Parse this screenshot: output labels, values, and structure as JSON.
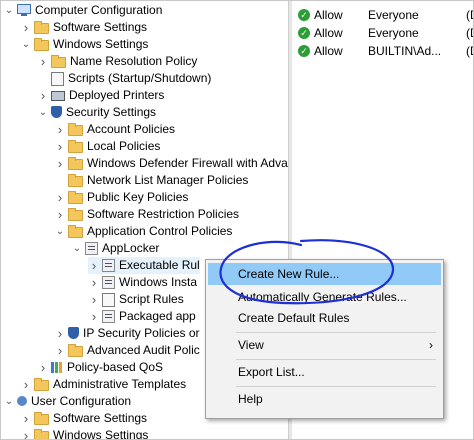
{
  "tree": [
    {
      "label": "Computer Configuration",
      "indent": 0,
      "toggle": "open",
      "icon": "pc"
    },
    {
      "label": "Software Settings",
      "indent": 1,
      "toggle": "closed",
      "icon": "folder"
    },
    {
      "label": "Windows Settings",
      "indent": 1,
      "toggle": "open",
      "icon": "folder"
    },
    {
      "label": "Name Resolution Policy",
      "indent": 2,
      "toggle": "closed",
      "icon": "folder"
    },
    {
      "label": "Scripts (Startup/Shutdown)",
      "indent": 2,
      "toggle": "none",
      "icon": "scroll"
    },
    {
      "label": "Deployed Printers",
      "indent": 2,
      "toggle": "closed",
      "icon": "printer"
    },
    {
      "label": "Security Settings",
      "indent": 2,
      "toggle": "open",
      "icon": "shield"
    },
    {
      "label": "Account Policies",
      "indent": 3,
      "toggle": "closed",
      "icon": "folder"
    },
    {
      "label": "Local Policies",
      "indent": 3,
      "toggle": "closed",
      "icon": "folder"
    },
    {
      "label": "Windows Defender Firewall with Advar",
      "indent": 3,
      "toggle": "closed",
      "icon": "folder"
    },
    {
      "label": "Network List Manager Policies",
      "indent": 3,
      "toggle": "none",
      "icon": "folder"
    },
    {
      "label": "Public Key Policies",
      "indent": 3,
      "toggle": "closed",
      "icon": "folder"
    },
    {
      "label": "Software Restriction Policies",
      "indent": 3,
      "toggle": "closed",
      "icon": "folder"
    },
    {
      "label": "Application Control Policies",
      "indent": 3,
      "toggle": "open",
      "icon": "folder"
    },
    {
      "label": "AppLocker",
      "indent": 4,
      "toggle": "open",
      "icon": "policy"
    },
    {
      "label": "Executable Rul",
      "indent": 5,
      "toggle": "closed",
      "icon": "policy",
      "selected": true
    },
    {
      "label": "Windows Insta",
      "indent": 5,
      "toggle": "closed",
      "icon": "policy"
    },
    {
      "label": "Script Rules",
      "indent": 5,
      "toggle": "closed",
      "icon": "scroll"
    },
    {
      "label": "Packaged app",
      "indent": 5,
      "toggle": "closed",
      "icon": "policy"
    },
    {
      "label": "IP Security Policies or",
      "indent": 3,
      "toggle": "closed",
      "icon": "shield"
    },
    {
      "label": "Advanced Audit Polic",
      "indent": 3,
      "toggle": "closed",
      "icon": "folder"
    },
    {
      "label": "Policy-based QoS",
      "indent": 2,
      "toggle": "closed",
      "icon": "bars"
    },
    {
      "label": "Administrative Templates",
      "indent": 1,
      "toggle": "closed",
      "icon": "folder"
    },
    {
      "label": "User Configuration",
      "indent": 0,
      "toggle": "open",
      "icon": "user"
    },
    {
      "label": "Software Settings",
      "indent": 1,
      "toggle": "closed",
      "icon": "folder"
    },
    {
      "label": "Windows Settings",
      "indent": 1,
      "toggle": "closed",
      "icon": "folder"
    }
  ],
  "rules": [
    {
      "action": "Allow",
      "user": "Everyone",
      "tail": "(De"
    },
    {
      "action": "Allow",
      "user": "Everyone",
      "tail": "(De"
    },
    {
      "action": "Allow",
      "user": "BUILTIN\\Ad...",
      "tail": "(De"
    }
  ],
  "menu": {
    "create_new_rule": "Create New Rule...",
    "auto_generate": "Automatically Generate Rules...",
    "create_default": "Create Default Rules",
    "view": "View",
    "export_list": "Export List...",
    "help": "Help",
    "submenu_arrow": "›"
  },
  "colors": {
    "highlight": "#91c9f7",
    "annotation": "#1f2fd6",
    "allow": "#2b9e36"
  }
}
